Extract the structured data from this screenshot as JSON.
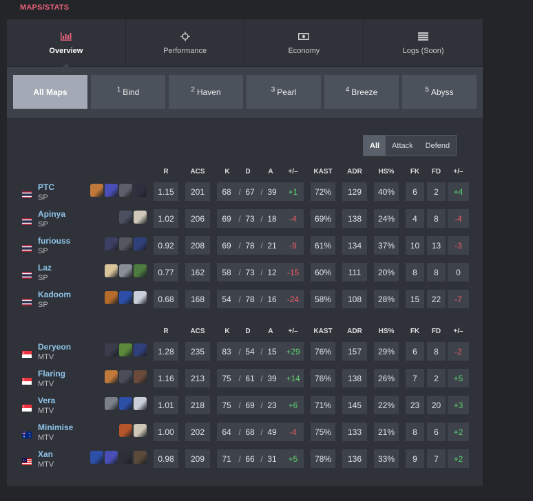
{
  "breadcrumb": "MAPS/STATS",
  "tabs": [
    {
      "label": "Overview",
      "icon": "bar-chart-icon",
      "active": true
    },
    {
      "label": "Performance",
      "icon": "crosshair-icon",
      "active": false
    },
    {
      "label": "Economy",
      "icon": "money-icon",
      "active": false
    },
    {
      "label": "Logs (Soon)",
      "icon": "list-icon",
      "active": false
    }
  ],
  "maps": [
    {
      "num": "",
      "name": "All Maps",
      "active": true
    },
    {
      "num": "1",
      "name": "Bind",
      "active": false
    },
    {
      "num": "2",
      "name": "Haven",
      "active": false
    },
    {
      "num": "3",
      "name": "Pearl",
      "active": false
    },
    {
      "num": "4",
      "name": "Breeze",
      "active": false
    },
    {
      "num": "5",
      "name": "Abyss",
      "active": false
    }
  ],
  "sides": [
    {
      "label": "All",
      "active": true
    },
    {
      "label": "Attack",
      "active": false
    },
    {
      "label": "Defend",
      "active": false
    }
  ],
  "columns": {
    "r": "R",
    "acs": "ACS",
    "k": "K",
    "d": "D",
    "a": "A",
    "pm": "+/–",
    "kast": "KAST",
    "adr": "ADR",
    "hs": "HS%",
    "fk": "FK",
    "fd": "FD",
    "fkpm": "+/–"
  },
  "separator": "/",
  "teams": [
    {
      "players": [
        {
          "name": "PTC",
          "team": "SP",
          "flag": "thailand",
          "agents": [
            "#c0793a",
            "#4a4fb8",
            "#5c5f6a",
            "#2e3040"
          ],
          "r": "1.15",
          "acs": "201",
          "k": "68",
          "d": "67",
          "a": "39",
          "pm": "+1",
          "kast": "72%",
          "adr": "129",
          "hs": "40%",
          "fk": "6",
          "fd": "2",
          "fkpm": "+4"
        },
        {
          "name": "Apinya",
          "team": "SP",
          "flag": "thailand",
          "agents": [
            "#4b5060",
            "#cfc7b8"
          ],
          "r": "1.02",
          "acs": "206",
          "k": "69",
          "d": "73",
          "a": "18",
          "pm": "-4",
          "kast": "69%",
          "adr": "138",
          "hs": "24%",
          "fk": "4",
          "fd": "8",
          "fkpm": "-4"
        },
        {
          "name": "furiouss",
          "team": "SP",
          "flag": "thailand",
          "agents": [
            "#3c3f63",
            "#55575f",
            "#2f3f7a"
          ],
          "r": "0.92",
          "acs": "208",
          "k": "69",
          "d": "78",
          "a": "21",
          "pm": "-9",
          "kast": "61%",
          "adr": "134",
          "hs": "37%",
          "fk": "10",
          "fd": "13",
          "fkpm": "-3"
        },
        {
          "name": "Laz",
          "team": "SP",
          "flag": "thailand",
          "agents": [
            "#d8c39a",
            "#8a8f96",
            "#4d7a3e"
          ],
          "r": "0.77",
          "acs": "162",
          "k": "58",
          "d": "73",
          "a": "12",
          "pm": "-15",
          "kast": "60%",
          "adr": "111",
          "hs": "20%",
          "fk": "8",
          "fd": "8",
          "fkpm": "0"
        },
        {
          "name": "Kadoom",
          "team": "SP",
          "flag": "thailand",
          "agents": [
            "#b56c2a",
            "#2d4fa8",
            "#c9ced8"
          ],
          "r": "0.68",
          "acs": "168",
          "k": "54",
          "d": "78",
          "a": "16",
          "pm": "-24",
          "kast": "58%",
          "adr": "108",
          "hs": "28%",
          "fk": "15",
          "fd": "22",
          "fkpm": "-7"
        }
      ]
    },
    {
      "players": [
        {
          "name": "Deryeon",
          "team": "MTV",
          "flag": "singapore",
          "agents": [
            "#3a3c4a",
            "#5a8a3a",
            "#2f3f7a"
          ],
          "r": "1.28",
          "acs": "235",
          "k": "83",
          "d": "54",
          "a": "15",
          "pm": "+29",
          "kast": "76%",
          "adr": "157",
          "hs": "29%",
          "fk": "6",
          "fd": "8",
          "fkpm": "-2"
        },
        {
          "name": "Flaring",
          "team": "MTV",
          "flag": "singapore",
          "agents": [
            "#c0793a",
            "#4a4d58",
            "#6b4a3a"
          ],
          "r": "1.16",
          "acs": "213",
          "k": "75",
          "d": "61",
          "a": "39",
          "pm": "+14",
          "kast": "76%",
          "adr": "138",
          "hs": "26%",
          "fk": "7",
          "fd": "2",
          "fkpm": "+5"
        },
        {
          "name": "Vera",
          "team": "MTV",
          "flag": "singapore",
          "agents": [
            "#7a7f88",
            "#2d4fa8",
            "#c9ced8"
          ],
          "r": "1.01",
          "acs": "218",
          "k": "75",
          "d": "69",
          "a": "23",
          "pm": "+6",
          "kast": "71%",
          "adr": "145",
          "hs": "22%",
          "fk": "23",
          "fd": "20",
          "fkpm": "+3"
        },
        {
          "name": "Minimise",
          "team": "MTV",
          "flag": "australia",
          "agents": [
            "#b5562a",
            "#cfc7b8"
          ],
          "r": "1.00",
          "acs": "202",
          "k": "64",
          "d": "68",
          "a": "49",
          "pm": "-4",
          "kast": "75%",
          "adr": "133",
          "hs": "21%",
          "fk": "8",
          "fd": "6",
          "fkpm": "+2"
        },
        {
          "name": "Xan",
          "team": "MTV",
          "flag": "malaysia",
          "agents": [
            "#2d4fa8",
            "#4a4fb8",
            "#2e2f36",
            "#5b4a3a"
          ],
          "r": "0.98",
          "acs": "209",
          "k": "71",
          "d": "66",
          "a": "31",
          "pm": "+5",
          "kast": "78%",
          "adr": "136",
          "hs": "33%",
          "fk": "9",
          "fd": "7",
          "fkpm": "+2"
        }
      ]
    }
  ]
}
